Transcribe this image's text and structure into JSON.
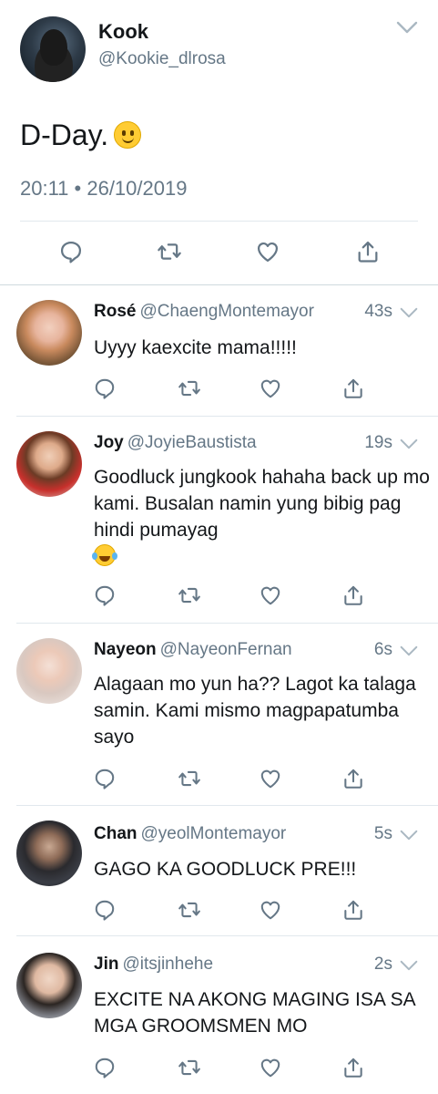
{
  "main_tweet": {
    "name": "Kook",
    "handle": "@Kookie_dlrosa",
    "text": "D-Day.",
    "emoji": "smile-emoji",
    "timestamp": "20:11 • 26/10/2019",
    "icons": [
      "reply-icon",
      "retweet-icon",
      "like-icon",
      "share-icon",
      "chevron-down-icon"
    ]
  },
  "replies": [
    {
      "name": "Rosé",
      "handle": "@ChaengMontemayor",
      "time": "43s",
      "text": "Uyyy kaexcite mama!!!!!"
    },
    {
      "name": "Joy",
      "handle": "@JoyieBaustista",
      "time": "19s",
      "text": "Goodluck jungkook hahaha back up mo kami. Busalan namin yung bibig pag hindi pumayag",
      "emoji": "laughing-tears-emoji"
    },
    {
      "name": "Nayeon",
      "handle": "@NayeonFernan",
      "time": "6s",
      "text": "Alagaan mo yun ha?? Lagot ka talaga samin. Kami mismo magpapatumba sayo"
    },
    {
      "name": "Chan",
      "handle": "@yeolMontemayor",
      "time": "5s",
      "text": "GAGO KA GOODLUCK PRE!!!"
    },
    {
      "name": "Jin",
      "handle": "@itsjinhehe",
      "time": "2s",
      "text": "EXCITE NA AKONG MAGING ISA SA MGA GROOMSMEN MO"
    }
  ],
  "colors": {
    "text": "#14171a",
    "secondary": "#657786",
    "icon": "#657786",
    "divider": "#e1e8ed"
  }
}
